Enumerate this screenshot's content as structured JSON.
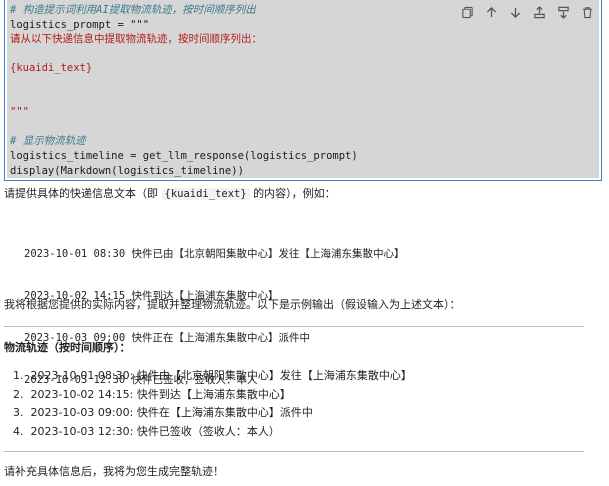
{
  "code_cell": {
    "lines": [
      {
        "cls": "cm",
        "text": "# 构造提示词利用AI提取物流轨迹，按时间顺序列出"
      },
      {
        "cls": "fn",
        "text": "logistics_prompt = \"\"\""
      },
      {
        "cls": "str",
        "text": "请从以下快递信息中提取物流轨迹，按时间顺序列出："
      },
      {
        "cls": "str",
        "text": ""
      },
      {
        "cls": "str",
        "text": "{kuaidi_text}"
      },
      {
        "cls": "str",
        "text": ""
      },
      {
        "cls": "str",
        "text": ""
      },
      {
        "cls": "str",
        "text": "\"\"\""
      },
      {
        "cls": "fn",
        "text": ""
      },
      {
        "cls": "cm",
        "text": "# 显示物流轨迹"
      },
      {
        "cls": "fn",
        "text": "logistics_timeline = get_llm_response(logistics_prompt)"
      },
      {
        "cls": "fn",
        "text": "display(Markdown(logistics_timeline))"
      }
    ]
  },
  "toolbar": {
    "icons": [
      "copy-icon",
      "move-up-icon",
      "move-down-icon",
      "insert-above-icon",
      "insert-below-icon",
      "delete-icon"
    ]
  },
  "output": {
    "intro_prefix": "请提供具体的快递信息文本（即 ",
    "intro_code": "{kuaidi_text}",
    "intro_suffix": " 的内容），例如：",
    "example_lines": [
      "2023-10-01 08:30 快件已由【北京朝阳集散中心】发往【上海浦东集散中心】",
      "2023-10-02 14:15 快件到达【上海浦东集散中心】",
      "2023-10-03 09:00 快件正在【上海浦东集散中心】派件中",
      "2023-10-03 12:30 快件已签收，签收人：本人"
    ],
    "explain": "我将根据您提供的实际内容，提取并整理物流轨迹。以下是示例输出（假设输入为上述文本）：",
    "heading": "物流轨迹（按时间顺序）：",
    "timeline": [
      "2023-10-01 08:30: 快件由【北京朝阳集散中心】发往【上海浦东集散中心】",
      "2023-10-02 14:15: 快件到达【上海浦东集散中心】",
      "2023-10-03 09:00: 快件在【上海浦东集散中心】派件中",
      "2023-10-03 12:30: 快件已签收（签收人：本人）"
    ],
    "closing": "请补充具体信息后，我将为您生成完整轨迹！"
  }
}
